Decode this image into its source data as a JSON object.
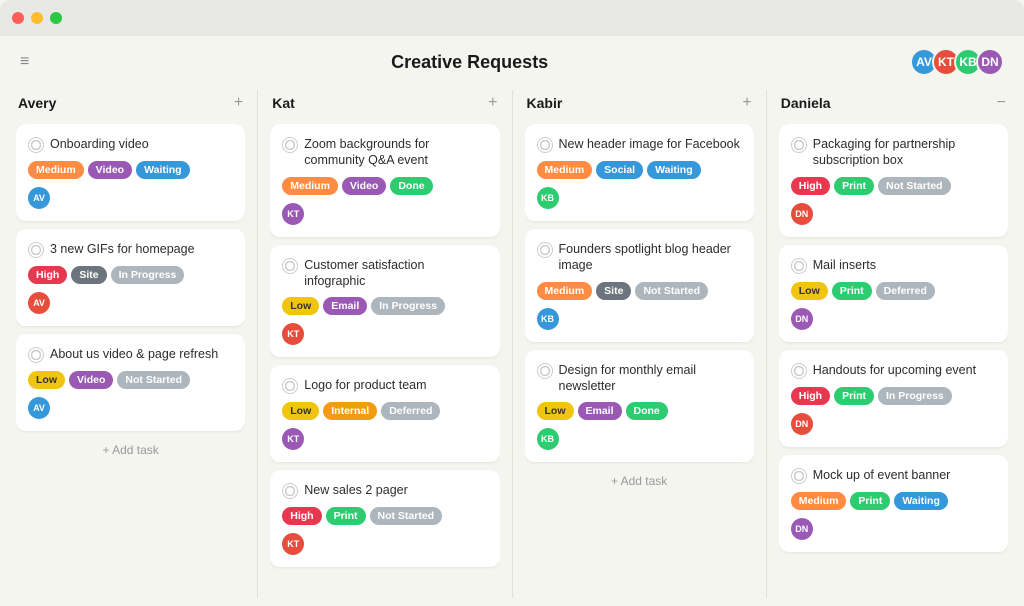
{
  "app": {
    "title": "Creative Requests"
  },
  "header": {
    "title": "Creative Requests",
    "menu_icon": "≡"
  },
  "columns": [
    {
      "id": "avery",
      "title": "Avery",
      "add_label": "+",
      "cards": [
        {
          "id": "card-1",
          "title": "Onboarding video",
          "tags": [
            {
              "label": "Medium",
              "type": "medium"
            },
            {
              "label": "Video",
              "type": "video"
            },
            {
              "label": "Waiting",
              "type": "waiting"
            }
          ],
          "avatar_color": "#3498db",
          "avatar_initials": "AV"
        },
        {
          "id": "card-2",
          "title": "3 new GIFs for homepage",
          "tags": [
            {
              "label": "High",
              "type": "high"
            },
            {
              "label": "Site",
              "type": "site"
            },
            {
              "label": "In Progress",
              "type": "in-progress"
            }
          ],
          "avatar_color": "#e74c3c",
          "avatar_initials": "AV"
        },
        {
          "id": "card-3",
          "title": "About us video & page refresh",
          "tags": [
            {
              "label": "Low",
              "type": "low"
            },
            {
              "label": "Video",
              "type": "video"
            },
            {
              "label": "Not Started",
              "type": "not-started"
            }
          ],
          "avatar_color": "#3498db",
          "avatar_initials": "AV"
        }
      ],
      "add_task_label": "+ Add task"
    },
    {
      "id": "kat",
      "title": "Kat",
      "add_label": "+",
      "cards": [
        {
          "id": "card-4",
          "title": "Zoom backgrounds for community Q&A event",
          "tags": [
            {
              "label": "Medium",
              "type": "medium"
            },
            {
              "label": "Video",
              "type": "video"
            },
            {
              "label": "Done",
              "type": "done"
            }
          ],
          "avatar_color": "#9b59b6",
          "avatar_initials": "KT"
        },
        {
          "id": "card-5",
          "title": "Customer satisfaction infographic",
          "tags": [
            {
              "label": "Low",
              "type": "low"
            },
            {
              "label": "Email",
              "type": "email"
            },
            {
              "label": "In Progress",
              "type": "in-progress"
            }
          ],
          "avatar_color": "#e74c3c",
          "avatar_initials": "KT"
        },
        {
          "id": "card-6",
          "title": "Logo for product team",
          "tags": [
            {
              "label": "Low",
              "type": "low"
            },
            {
              "label": "Internal",
              "type": "internal"
            },
            {
              "label": "Deferred",
              "type": "deferred"
            }
          ],
          "avatar_color": "#9b59b6",
          "avatar_initials": "KT"
        },
        {
          "id": "card-7",
          "title": "New sales 2 pager",
          "tags": [
            {
              "label": "High",
              "type": "high"
            },
            {
              "label": "Print",
              "type": "print"
            },
            {
              "label": "Not Started",
              "type": "not-started"
            }
          ],
          "avatar_color": "#e74c3c",
          "avatar_initials": "KT"
        }
      ],
      "add_task_label": ""
    },
    {
      "id": "kabir",
      "title": "Kabir",
      "add_label": "+",
      "cards": [
        {
          "id": "card-8",
          "title": "New header image for Facebook",
          "tags": [
            {
              "label": "Medium",
              "type": "medium"
            },
            {
              "label": "Social",
              "type": "social"
            },
            {
              "label": "Waiting",
              "type": "waiting"
            }
          ],
          "avatar_color": "#2ecc71",
          "avatar_initials": "KB"
        },
        {
          "id": "card-9",
          "title": "Founders spotlight blog header image",
          "tags": [
            {
              "label": "Medium",
              "type": "medium"
            },
            {
              "label": "Site",
              "type": "site"
            },
            {
              "label": "Not Started",
              "type": "not-started"
            }
          ],
          "avatar_color": "#3498db",
          "avatar_initials": "KB"
        },
        {
          "id": "card-10",
          "title": "Design for monthly email newsletter",
          "tags": [
            {
              "label": "Low",
              "type": "low"
            },
            {
              "label": "Email",
              "type": "email"
            },
            {
              "label": "Done",
              "type": "done"
            }
          ],
          "avatar_color": "#2ecc71",
          "avatar_initials": "KB"
        }
      ],
      "add_task_label": "+ Add task"
    },
    {
      "id": "daniela",
      "title": "Daniela",
      "add_label": "−",
      "cards": [
        {
          "id": "card-11",
          "title": "Packaging for partnership subscription box",
          "tags": [
            {
              "label": "High",
              "type": "high"
            },
            {
              "label": "Print",
              "type": "print"
            },
            {
              "label": "Not Started",
              "type": "not-started"
            }
          ],
          "avatar_color": "#e74c3c",
          "avatar_initials": "DN"
        },
        {
          "id": "card-12",
          "title": "Mail inserts",
          "tags": [
            {
              "label": "Low",
              "type": "low"
            },
            {
              "label": "Print",
              "type": "print"
            },
            {
              "label": "Deferred",
              "type": "deferred"
            }
          ],
          "avatar_color": "#9b59b6",
          "avatar_initials": "DN"
        },
        {
          "id": "card-13",
          "title": "Handouts for upcoming event",
          "tags": [
            {
              "label": "High",
              "type": "high"
            },
            {
              "label": "Print",
              "type": "print"
            },
            {
              "label": "In Progress",
              "type": "in-progress"
            }
          ],
          "avatar_color": "#e74c3c",
          "avatar_initials": "DN"
        },
        {
          "id": "card-14",
          "title": "Mock up of event banner",
          "tags": [
            {
              "label": "Medium",
              "type": "medium"
            },
            {
              "label": "Print",
              "type": "print"
            },
            {
              "label": "Waiting",
              "type": "waiting"
            }
          ],
          "avatar_color": "#9b59b6",
          "avatar_initials": "DN"
        }
      ],
      "add_task_label": ""
    }
  ],
  "avatars": [
    {
      "color": "#3498db",
      "initials": "AV"
    },
    {
      "color": "#e74c3c",
      "initials": "KT"
    },
    {
      "color": "#2ecc71",
      "initials": "KB"
    },
    {
      "color": "#9b59b6",
      "initials": "DN"
    }
  ]
}
